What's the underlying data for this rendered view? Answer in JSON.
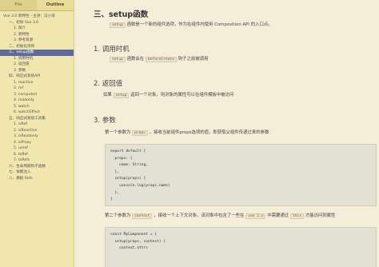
{
  "sidebar": {
    "tabs": [
      {
        "label": "File",
        "active": false
      },
      {
        "label": "Outline",
        "active": true
      }
    ],
    "items": [
      {
        "label": "Vue 3.0 新特性 - 主讲：冯小泽",
        "level": 0
      },
      {
        "label": "一、初探 Vue 3.0",
        "level": 1
      },
      {
        "label": "1. 简介",
        "level": 2
      },
      {
        "label": "2. 新特性",
        "level": 2
      },
      {
        "label": "3. 参考资源",
        "level": 2
      },
      {
        "label": "二、初始化项目",
        "level": 1
      },
      {
        "label": "三、setup函数",
        "level": 1,
        "selected": true
      },
      {
        "label": "1. 调用时机",
        "level": 2
      },
      {
        "label": "2. 返回值",
        "level": 2
      },
      {
        "label": "3. 参数",
        "level": 2
      },
      {
        "label": "四、响应式系统API",
        "level": 1
      },
      {
        "label": "1. reactive",
        "level": 2
      },
      {
        "label": "2. ref",
        "level": 2
      },
      {
        "label": "3. computed",
        "level": 2
      },
      {
        "label": "4. readonly",
        "level": 2
      },
      {
        "label": "5. watch",
        "level": 2
      },
      {
        "label": "6. watchEffect",
        "level": 2
      },
      {
        "label": "五、响应式系统工具集",
        "level": 1
      },
      {
        "label": "1. isRef",
        "level": 2
      },
      {
        "label": "2. isReactive",
        "level": 2
      },
      {
        "label": "3. isReadonly",
        "level": 2
      },
      {
        "label": "4. isProxy",
        "level": 2
      },
      {
        "label": "5. unref",
        "level": 2
      },
      {
        "label": "6. toRef",
        "level": 2
      },
      {
        "label": "7. toRefs",
        "level": 2
      },
      {
        "label": "六、生命周期钩子函数",
        "level": 1
      },
      {
        "label": "七、依赖注入",
        "level": 1
      },
      {
        "label": "八、模板 Refs",
        "level": 1
      }
    ]
  },
  "content": {
    "section_title": "三、setup函数",
    "intro": {
      "code": "setup",
      "text": "函数是一个新的组件选项，作为在组件内使用 Composition API 的入口点。"
    },
    "h_call": "1. 调用时机",
    "call_para": {
      "code1": "setup",
      "text1": "函数会在",
      "code2": "beforeCreate",
      "text2": "钩子之前被调用"
    },
    "h_return": "2. 返回值",
    "return_para": {
      "pre": "如果",
      "code": "setup",
      "text": "返回一个对象，则对象的属性可以在组件模板中被访问"
    },
    "h_params": "3. 参数",
    "param1": {
      "pre": "第一个参数为",
      "code": "props",
      "text": "，接收当前组件props选项的值，即获取父组件传递过来的参数"
    },
    "code1": [
      "export default {",
      "  props: {",
      "    name: String,",
      "  },",
      "  setup(props) {",
      "    console.log(props.name)",
      "  },",
      "}"
    ],
    "param2": {
      "pre": "第二个参数为",
      "code1": "context",
      "text1": "，接收一个上下文对象，该对象中包含了一些在",
      "code2": "vue 2.x",
      "text2": "中需要通过",
      "code3": "this",
      "text3": "才能访问到属性"
    },
    "code2": [
      "const MyComponent = {",
      "  setup(props, context) {",
      "    context.attrs"
    ]
  }
}
